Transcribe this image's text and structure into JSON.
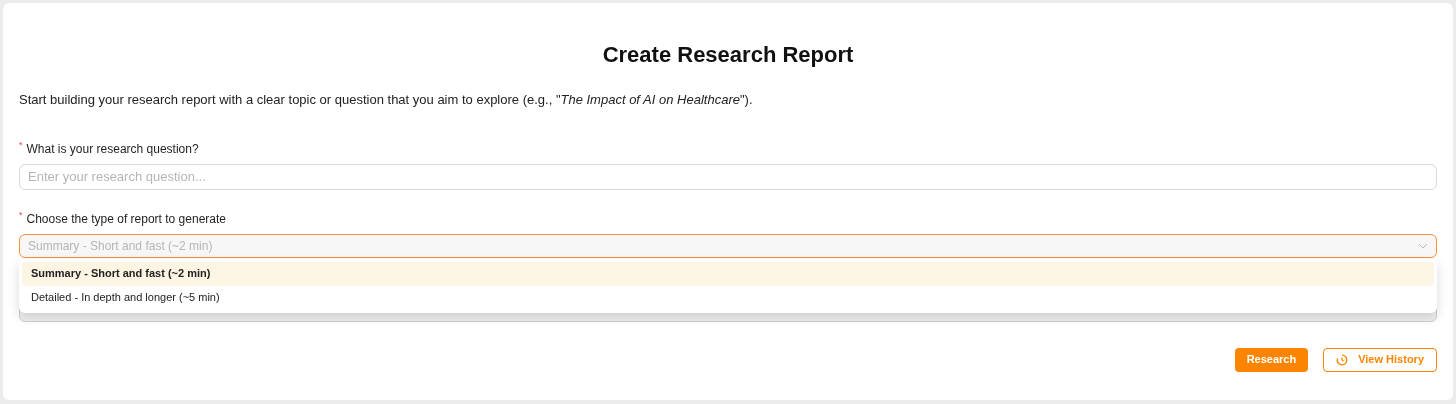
{
  "title": "Create Research Report",
  "intro": "Start building your research report with a clear topic or question that you aim to explore (e.g., \"*The Impact of AI on Healthcare*\").",
  "question_field": {
    "required_mark": "*",
    "label": "What is your research question?",
    "placeholder": "Enter your research question..."
  },
  "report_type_field": {
    "required_mark": "*",
    "label": "Choose the type of report to generate",
    "placeholder": "Summary - Short and fast (~2 min)",
    "expanded": true,
    "options": [
      {
        "label": "Summary - Short and fast (~2 min)",
        "selected": true
      },
      {
        "label": "Detailed - In depth and longer (~5 min)",
        "selected": false
      }
    ]
  },
  "buttons": [
    {
      "kind": "primary",
      "label": "Research"
    },
    {
      "kind": "history",
      "label": "View History"
    }
  ]
}
